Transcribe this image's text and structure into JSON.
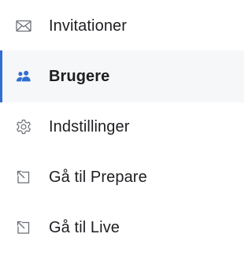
{
  "nav": {
    "items": [
      {
        "label": "Invitationer",
        "icon": "envelope-icon",
        "active": false
      },
      {
        "label": "Brugere",
        "icon": "users-icon",
        "active": true
      },
      {
        "label": "Indstillinger",
        "icon": "gear-icon",
        "active": false
      },
      {
        "label": "Gå til Prepare",
        "icon": "external-link-icon",
        "active": false
      },
      {
        "label": "Gå til Live",
        "icon": "external-link-icon",
        "active": false
      }
    ]
  },
  "colors": {
    "accent": "#2f6fd0",
    "active_bg": "#f6f7f8",
    "text": "#1d1f22",
    "icon": "#6b6f75"
  }
}
